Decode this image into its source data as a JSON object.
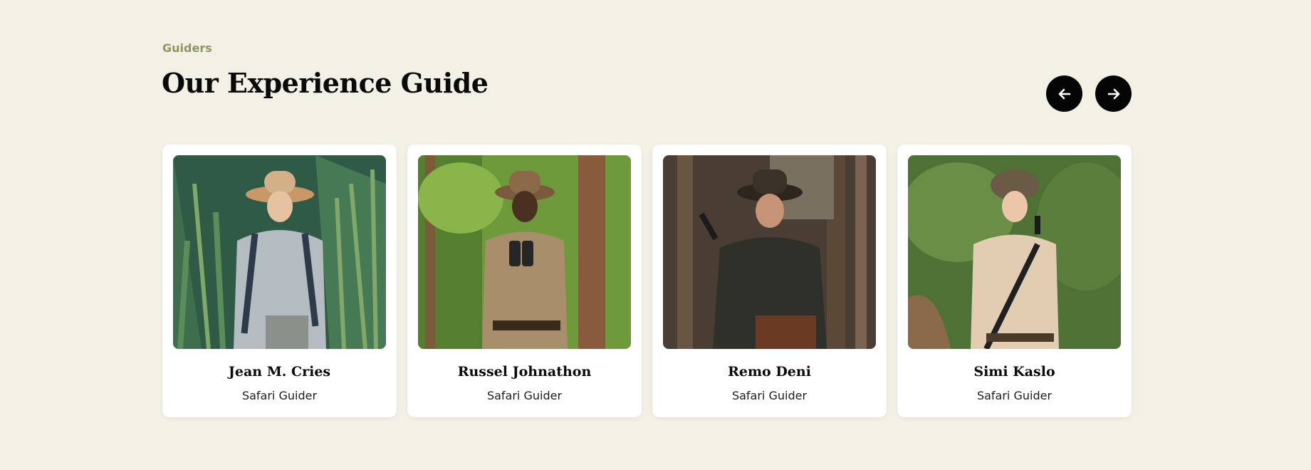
{
  "section": {
    "eyebrow": "Guiders",
    "title": "Our Experience Guide"
  },
  "navigation": {
    "prev_icon": "arrow-left-icon",
    "next_icon": "arrow-right-icon"
  },
  "guides": [
    {
      "name": "Jean M. Cries",
      "role": "Safari Guider"
    },
    {
      "name": "Russel Johnathon",
      "role": "Safari Guider"
    },
    {
      "name": "Remo Deni",
      "role": "Safari Guider"
    },
    {
      "name": "Simi Kaslo",
      "role": "Safari Guider"
    }
  ],
  "colors": {
    "background": "#f3f0e5",
    "accent": "#8f9660",
    "button": "#050505"
  }
}
